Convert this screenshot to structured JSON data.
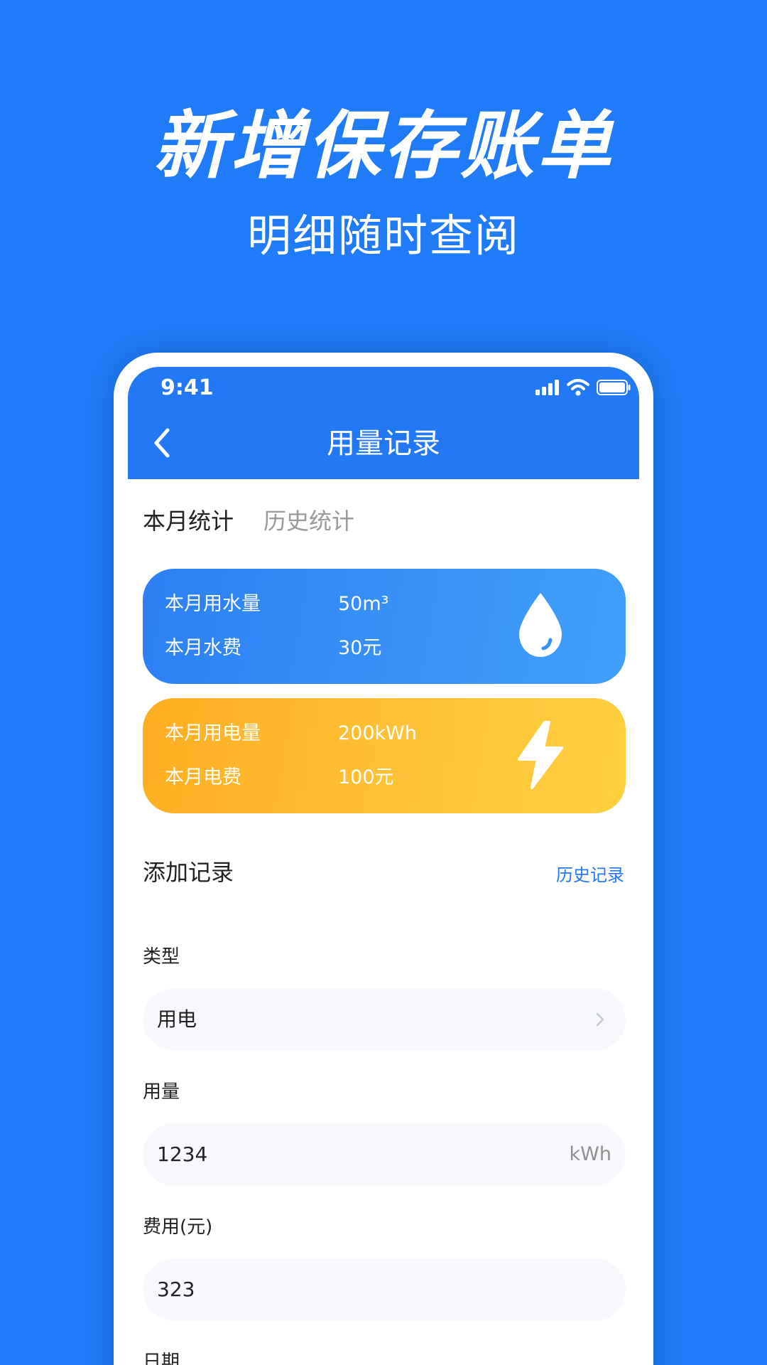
{
  "promo": {
    "headline": "新增保存账单",
    "subline": "明细随时查阅"
  },
  "status_bar": {
    "time": "9:41",
    "icons": [
      "signal-icon",
      "wifi-icon",
      "battery-icon"
    ]
  },
  "nav": {
    "back_icon": "chevron-left-icon",
    "title": "用量记录"
  },
  "tabs": [
    {
      "label": "本月统计",
      "active": true
    },
    {
      "label": "历史统计",
      "active": false
    }
  ],
  "water_card": {
    "usage_label": "本月用水量",
    "usage_value": "50m³",
    "fee_label": "本月水费",
    "fee_value": "30元",
    "icon": "water-drop-icon",
    "color": "#2b7ff3"
  },
  "power_card": {
    "usage_label": "本月用电量",
    "usage_value": "200kWh",
    "fee_label": "本月电费",
    "fee_value": "100元",
    "icon": "lightning-icon",
    "color": "#ffb427"
  },
  "add_record": {
    "title": "添加记录",
    "history_link": "历史记录"
  },
  "form": {
    "type_label": "类型",
    "type_value": "用电",
    "usage_label": "用量",
    "usage_value": "1234",
    "usage_unit": "kWh",
    "fee_label": "费用(元)",
    "fee_value": "323",
    "date_label": "日期"
  },
  "colors": {
    "background": "#1f7bf7",
    "primary": "#2379f5",
    "field_bg": "#f6f8fc"
  }
}
